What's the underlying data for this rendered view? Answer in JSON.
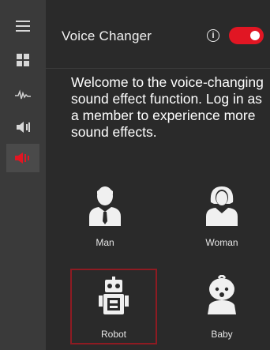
{
  "sidebar": {
    "items": [
      {
        "icon": "menu-icon"
      },
      {
        "icon": "grid-icon"
      },
      {
        "icon": "waveform-icon"
      },
      {
        "icon": "speaker-icon"
      },
      {
        "icon": "voice-changer-icon",
        "active": true
      }
    ]
  },
  "header": {
    "title": "Voice Changer",
    "info_icon": "i",
    "toggle_on": true
  },
  "welcome": "Welcome to the voice-changing sound effect function. Log in as a member to experience more sound effects.",
  "effects": [
    {
      "label": "Man",
      "icon": "man-icon"
    },
    {
      "label": "Woman",
      "icon": "woman-icon"
    },
    {
      "label": "Robot",
      "icon": "robot-icon",
      "selected": true
    },
    {
      "label": "Baby",
      "icon": "baby-icon"
    }
  ],
  "colors": {
    "accent": "#e11623",
    "selected_border": "#8e1b22",
    "background": "#2a2a2a",
    "sidebar": "#3a3a3a"
  }
}
